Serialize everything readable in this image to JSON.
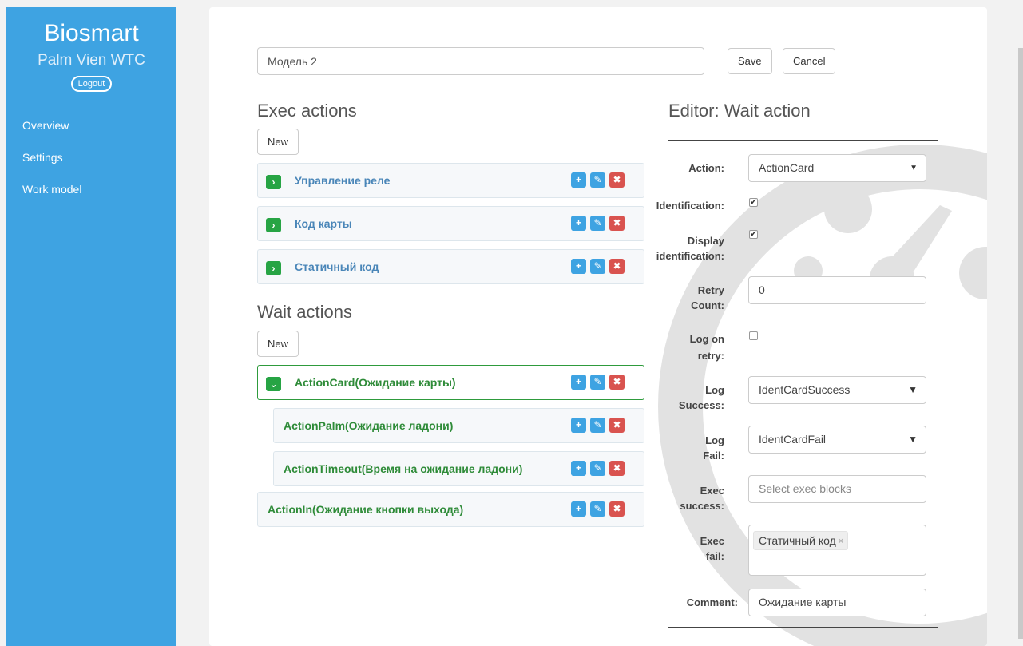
{
  "sidebar": {
    "brand": "Biosmart",
    "subtitle": "Palm Vien WTC",
    "logout_label": "Logout",
    "nav": [
      "Overview",
      "Settings",
      "Work model"
    ]
  },
  "model": {
    "name": "Модель 2"
  },
  "toolbar": {
    "save_label": "Save",
    "cancel_label": "Cancel"
  },
  "exec_section": {
    "title": "Exec actions",
    "new_label": "New",
    "items": [
      "Управление реле",
      "Код карты",
      "Статичный код"
    ]
  },
  "wait_section": {
    "title": "Wait actions",
    "new_label": "New",
    "items": [
      "ActionCard(Ожидание карты)",
      "ActionPalm(Ожидание ладони)",
      "ActionTimeout(Время на ожидание ладони)",
      "ActionIn(Ожидание кнопки выхода)"
    ]
  },
  "editor": {
    "title": "Editor: Wait action",
    "action_label": "Action:",
    "action_value": "ActionCard",
    "identification_label": "Identification:",
    "identification_checked": true,
    "display_identification_label_1": "Display",
    "display_identification_label_2": "identification:",
    "display_identification_checked": true,
    "retry_label_1": "Retry",
    "retry_label_2": "Count:",
    "retry_value": "0",
    "log_retry_label_1": "Log on",
    "log_retry_label_2": "retry:",
    "log_retry_checked": false,
    "log_success_label_1": "Log",
    "log_success_label_2": "Success:",
    "log_success_value": "IdentCardSuccess",
    "log_fail_label_1": "Log",
    "log_fail_label_2": "Fail:",
    "log_fail_value": "IdentCardFail",
    "exec_success_label_1": "Exec",
    "exec_success_label_2": "success:",
    "exec_success_placeholder": "Select exec blocks",
    "exec_fail_label_1": "Exec",
    "exec_fail_label_2": "fail:",
    "exec_fail_tag": "Статичный код",
    "comment_label": "Comment:",
    "comment_value": "Ожидание карты"
  },
  "colors": {
    "sidebar": "#3ea3e2",
    "green": "#27a444",
    "blue_btn": "#3ea3e2",
    "red_btn": "#d9534f"
  },
  "icons": {
    "expand": "chevron-right-icon",
    "collapse": "chevron-down-icon",
    "add": "plus-icon",
    "edit": "edit-icon",
    "delete": "close-icon"
  }
}
